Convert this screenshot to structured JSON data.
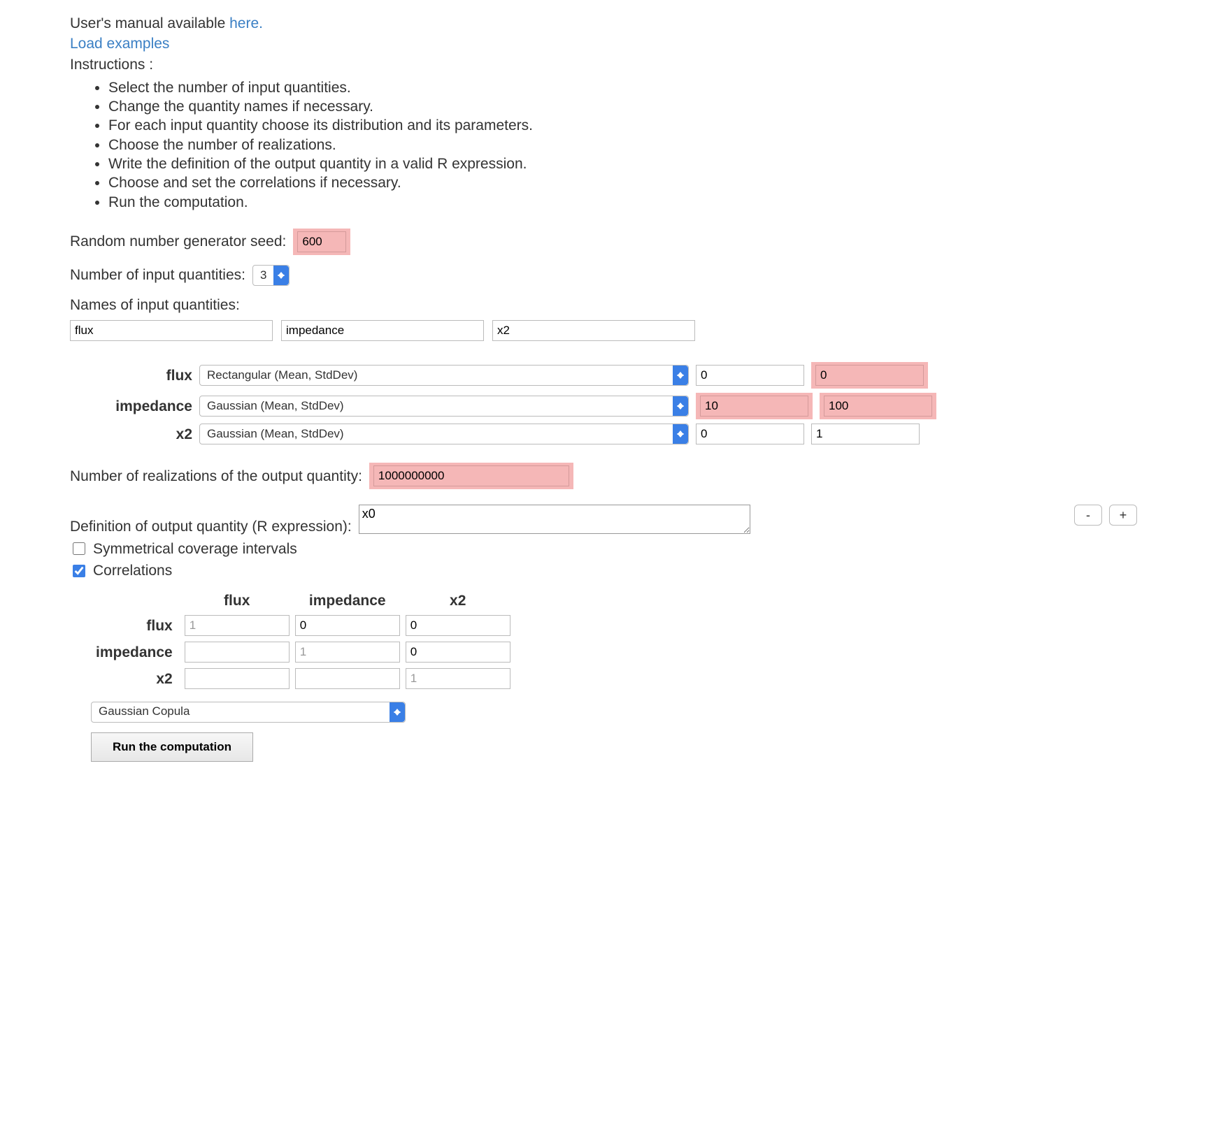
{
  "intro": {
    "manual_prefix": "User's manual available ",
    "manual_link": "here.",
    "load_examples": "Load examples",
    "instructions_label": "Instructions :",
    "steps": [
      "Select the number of input quantities.",
      "Change the quantity names if necessary.",
      "For each input quantity choose its distribution and its parameters.",
      "Choose the number of realizations.",
      "Write the definition of the output quantity in a valid R expression.",
      "Choose and set the correlations if necessary.",
      "Run the computation."
    ]
  },
  "seed": {
    "label": "Random number generator seed:",
    "value": "600"
  },
  "nq": {
    "label": "Number of input quantities:",
    "value": "3"
  },
  "names": {
    "label": "Names of input quantities:",
    "v": [
      "flux",
      "impedance",
      "x2"
    ]
  },
  "dist": {
    "rows": [
      {
        "name": "flux",
        "dist": "Rectangular (Mean, StdDev)",
        "p1": "0",
        "p2": "0",
        "hl1": false,
        "hl2": true
      },
      {
        "name": "impedance",
        "dist": "Gaussian (Mean, StdDev)",
        "p1": "10",
        "p2": "100",
        "hl1": true,
        "hl2": true
      },
      {
        "name": "x2",
        "dist": "Gaussian (Mean, StdDev)",
        "p1": "0",
        "p2": "1",
        "hl1": false,
        "hl2": false
      }
    ]
  },
  "realizations": {
    "label": "Number of realizations of the output quantity:",
    "value": "1000000000"
  },
  "output": {
    "label": "Definition of output quantity (R expression):",
    "value": "x0",
    "minus": "-",
    "plus": "+"
  },
  "checks": {
    "sym_label": "Symmetrical coverage intervals",
    "sym_checked": false,
    "corr_label": "Correlations",
    "corr_checked": true
  },
  "corr": {
    "headers": [
      "flux",
      "impedance",
      "x2"
    ],
    "rows": [
      {
        "name": "flux",
        "cells": [
          "1",
          "0",
          "0"
        ],
        "diag": 0
      },
      {
        "name": "impedance",
        "cells": [
          "",
          "1",
          "0"
        ],
        "diag": 1
      },
      {
        "name": "x2",
        "cells": [
          "",
          "",
          "1"
        ],
        "diag": 2
      }
    ],
    "copula": "Gaussian Copula"
  },
  "run_label": "Run the computation"
}
